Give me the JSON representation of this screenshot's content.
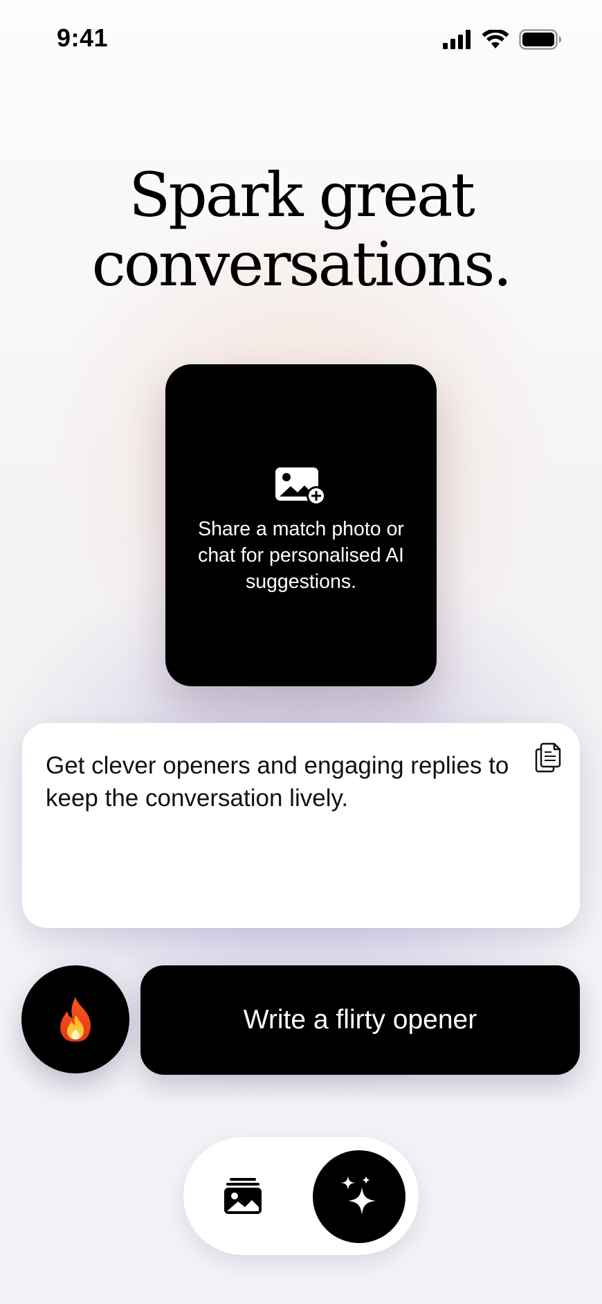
{
  "status_bar": {
    "time": "9:41",
    "icons": [
      "cellular-signal-icon",
      "wifi-icon",
      "battery-icon"
    ]
  },
  "title": {
    "line1": "Spark great",
    "line2": "conversations."
  },
  "upload_card": {
    "icon": "add-photo-icon",
    "text": "Share a match photo or chat for personalised AI suggestions."
  },
  "suggestion_card": {
    "text": "Get clever openers and engaging replies to keep the conversation lively.",
    "copy_icon": "copy-icon"
  },
  "actions": {
    "fire_icon": "🔥",
    "primary_label": "Write a flirty opener"
  },
  "bottom_nav": {
    "items": [
      {
        "icon": "photo-stack-icon",
        "active": false
      },
      {
        "icon": "sparkles-icon",
        "active": true
      }
    ]
  },
  "colors": {
    "primary": "#000000",
    "card": "#ffffff",
    "glow_warm": "#eed4c3",
    "glow_cool": "#bcb6de"
  }
}
